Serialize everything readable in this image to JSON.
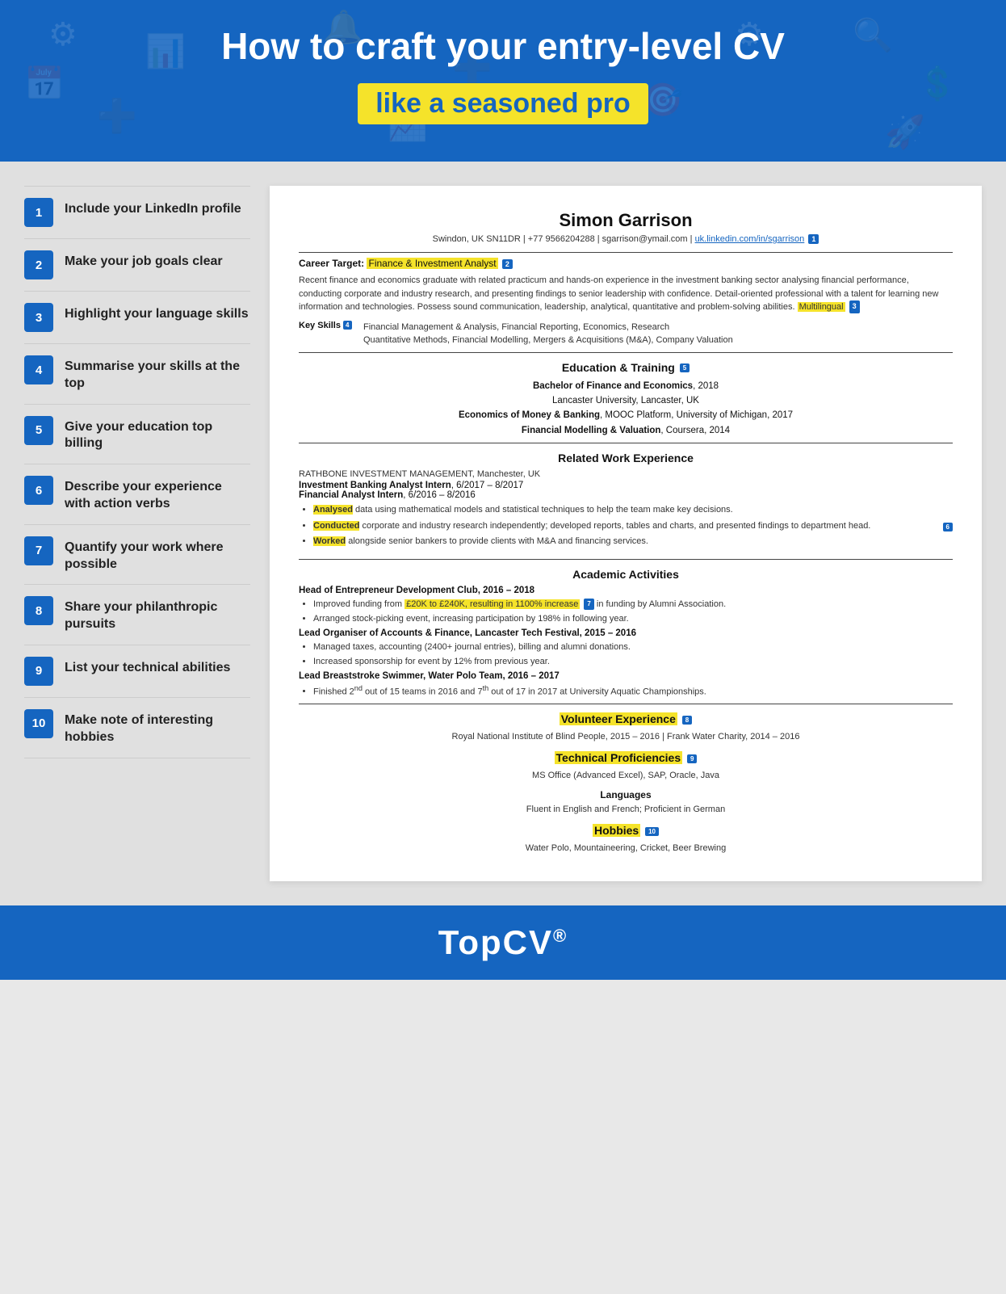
{
  "header": {
    "title": "How to craft your entry-level CV",
    "subtitle": "like a seasoned pro"
  },
  "tips": [
    {
      "number": "1",
      "text": "Include your LinkedIn profile"
    },
    {
      "number": "2",
      "text": "Make your job goals clear"
    },
    {
      "number": "3",
      "text": "Highlight your language skills"
    },
    {
      "number": "4",
      "text": "Summarise your skills at the top"
    },
    {
      "number": "5",
      "text": "Give your education top billing"
    },
    {
      "number": "6",
      "text": "Describe your experience with action verbs"
    },
    {
      "number": "7",
      "text": "Quantify your work where possible"
    },
    {
      "number": "8",
      "text": "Share your philanthropic pursuits"
    },
    {
      "number": "9",
      "text": "List your technical abilities"
    },
    {
      "number": "10",
      "text": "Make note of interesting hobbies"
    }
  ],
  "cv": {
    "name": "Simon Garrison",
    "contact": "Swindon, UK SN11DR | +77 9566204288 | sgarrison@ymail.com |",
    "linkedin_text": "uk.linkedin.com/in/sgarrison",
    "linkedin_badge": "1",
    "career_target_label": "Career Target:",
    "career_target_role": "Finance & Investment Analyst",
    "career_target_badge": "2",
    "summary": "Recent finance and economics graduate with related practicum and hands-on experience in the investment banking sector analysing financial performance, conducting corporate and industry research, and presenting findings to senior leadership with confidence. Detail-oriented professional with a talent for learning new information and technologies. Possess sound communication, leadership, analytical, quantitative and problem-solving abilities.",
    "multilingual_text": "Multilingual",
    "multilingual_badge": "3",
    "key_skills_label": "Key Skills",
    "key_skills_badge": "4",
    "key_skills": "Financial Management & Analysis, Financial Reporting, Economics, Research\nQuantitative Methods, Financial Modelling, Mergers & Acquisitions (M&A), Company Valuation",
    "education_header": "Education & Training",
    "education_badge": "5",
    "education_entries": [
      {
        "bold": "Bachelor of Finance and Economics",
        "detail": ", 2018"
      },
      {
        "plain": "Lancaster University, Lancaster, UK"
      },
      {
        "bold": "Economics of Money & Banking",
        "detail": ", MOOC Platform, University of Michigan, 2017"
      },
      {
        "bold": "Financial Modelling & Valuation",
        "detail": ", Coursera, 2014"
      }
    ],
    "work_header": "Related Work Experience",
    "work_company": "RATHBONE INVESTMENT MANAGEMENT, Manchester, UK",
    "work_title1": "Investment Banking Analyst Intern",
    "work_dates1": ", 6/2017 – 8/2017",
    "work_title2": "Financial Analyst Intern",
    "work_dates2": ", 6/2016 – 8/2016",
    "work_badge": "6",
    "work_bullets": [
      {
        "verb": "Analysed",
        "rest": " data using mathematical models and statistical techniques to help the team make key decisions."
      },
      {
        "verb": "Conducted",
        "rest": " corporate and industry research independently; developed reports, tables and charts, and presented findings to department head."
      },
      {
        "verb": "Worked",
        "rest": " alongside senior bankers to provide clients with M&A and financing services."
      }
    ],
    "academic_header": "Academic Activities",
    "academic_activities": [
      {
        "title": "Head of Entrepreneur Development Club",
        "dates": ", 2016 – 2018",
        "bullets": [
          {
            "pre": "Improved funding from ",
            "highlight": "£20K to £240K, resulting in 1100% increase",
            "badge": "7",
            "post": " in funding by Alumni Association."
          },
          {
            "plain": "Arranged stock-picking event, increasing participation by 198% in following year."
          }
        ]
      },
      {
        "title": "Lead Organiser of Accounts & Finance, Lancaster Tech Festival",
        "dates": ", 2015 – 2016",
        "bullets": [
          {
            "plain": "Managed taxes, accounting (2400+ journal entries), billing and alumni donations."
          },
          {
            "plain": "Increased sponsorship for event by 12% from previous year."
          }
        ]
      },
      {
        "title": "Lead Breaststroke Swimmer, Water Polo Team",
        "dates": ", 2016 – 2017",
        "bullets": [
          {
            "plain": "Finished 2nd out of 15 teams in 2016 and 7th out of 17 in 2017 at University Aquatic Championships."
          }
        ]
      }
    ],
    "volunteer_header": "Volunteer Experience",
    "volunteer_badge": "8",
    "volunteer_text": "Royal National Institute of Blind People, 2015 – 2016 | Frank Water Charity, 2014 – 2016",
    "tech_header": "Technical Proficiencies",
    "tech_badge": "9",
    "tech_text": "MS Office (Advanced Excel), SAP, Oracle, Java",
    "languages_header": "Languages",
    "languages_text": "Fluent in English and French; Proficient in German",
    "hobbies_header": "Hobbies",
    "hobbies_badge": "10",
    "hobbies_text": "Water Polo, Mountaineering, Cricket, Beer Brewing"
  },
  "footer": {
    "logo": "TopCV",
    "logo_symbol": "®"
  }
}
